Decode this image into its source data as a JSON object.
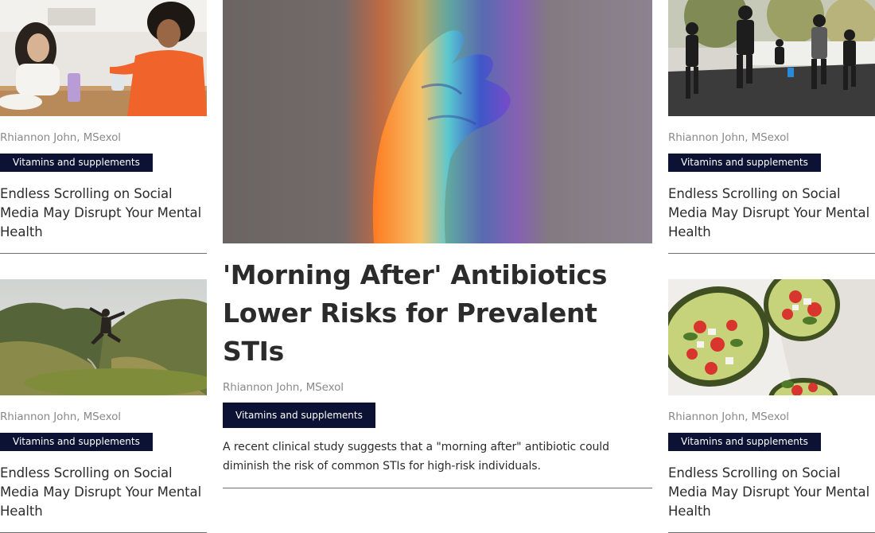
{
  "feature": {
    "title": "'Morning After' Antibiotics Lower Risks for Prevalent STIs",
    "author": "Rhiannon John, MSexol",
    "tag": "Vitamins and supplements",
    "excerpt": "A recent clinical study suggests that a \"morning after\" antibiotic could diminish the risk of common STIs for high-risk individuals.",
    "image": "hand-rainbow-light-photo"
  },
  "left_cards": [
    {
      "image": "two-women-kitchen-photo",
      "author": "Rhiannon John, MSexol",
      "tag": "Vitamins and supplements",
      "title": "Endless Scrolling on Social Media May Disrupt Your Mental Health"
    },
    {
      "image": "mountain-jump-photo",
      "author": "Rhiannon John, MSexol",
      "tag": "Vitamins and supplements",
      "title": "Endless Scrolling on Social Media May Disrupt Your Mental Health"
    }
  ],
  "right_cards": [
    {
      "image": "street-runners-photo",
      "author": "Rhiannon John, MSexol",
      "tag": "Vitamins and supplements",
      "title": "Endless Scrolling on Social Media May Disrupt Your Mental Health"
    },
    {
      "image": "avocado-salad-photo",
      "author": "Rhiannon John, MSexol",
      "tag": "Vitamins and supplements",
      "title": "Endless Scrolling on Social Media May Disrupt Your Mental Health"
    }
  ],
  "colors": {
    "tag_background": "#0c1233",
    "tag_text": "#ffffff",
    "author_text": "#8a8a8a",
    "title_text": "#2b2b2b",
    "divider": "#6f6f6f"
  }
}
